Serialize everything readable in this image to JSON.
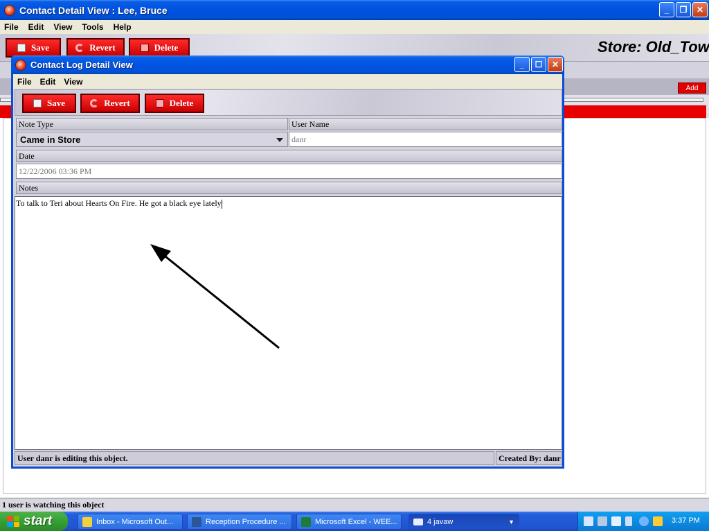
{
  "main_window": {
    "title": "Contact Detail View : Lee, Bruce",
    "menu": [
      "File",
      "Edit",
      "View",
      "Tools",
      "Help"
    ],
    "toolbar": {
      "save_label": "Save",
      "revert_label": "Revert",
      "delete_label": "Delete"
    },
    "store_label": "Store: Old_Town",
    "add_label": "Add",
    "watching_status": "1 user is watching this object"
  },
  "dialog": {
    "title": "Contact Log Detail View",
    "menu": [
      "File",
      "Edit",
      "View"
    ],
    "toolbar": {
      "save_label": "Save",
      "revert_label": "Revert",
      "delete_label": "Delete"
    },
    "note_type_label": "Note Type",
    "note_type_value": "Came in Store",
    "user_name_label": "User Name",
    "user_name_value": "danr",
    "date_label": "Date",
    "date_value": "12/22/2006 03:36 PM",
    "notes_label": "Notes",
    "notes_value": "To talk to Teri about Hearts On Fire. He got a black eye lately",
    "status_editing": "User danr is editing this object.",
    "status_created": "Created By: danr"
  },
  "taskbar": {
    "start_label": "start",
    "tasks": [
      {
        "label": "Inbox - Microsoft Out..."
      },
      {
        "label": "Reception Procedure ..."
      },
      {
        "label": "Microsoft Excel - WEE..."
      },
      {
        "label": "4 javaw"
      }
    ],
    "clock": "3:37 PM"
  },
  "colors": {
    "xp_blue": "#0053e1",
    "button_red": "#e00000",
    "taskbar_green": "#35a033"
  }
}
